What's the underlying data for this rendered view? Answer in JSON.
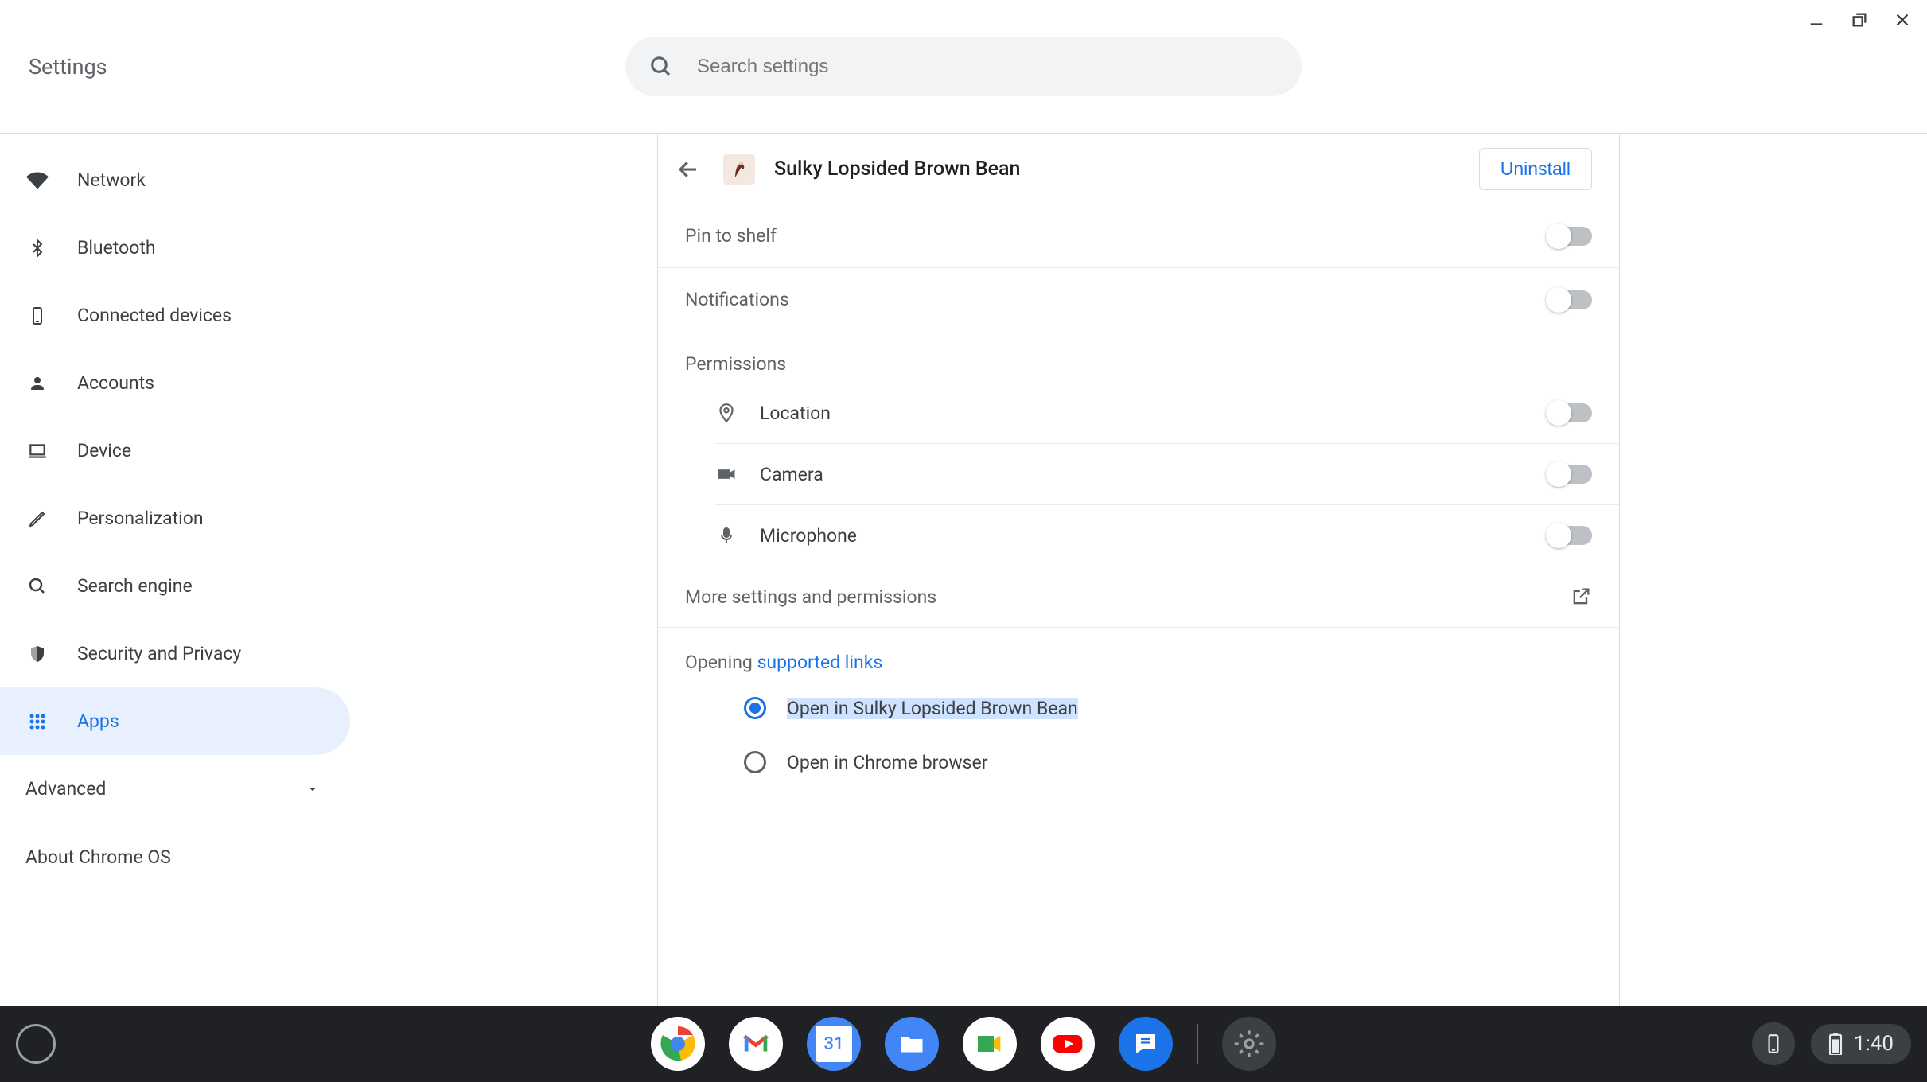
{
  "header": {
    "title": "Settings",
    "search_placeholder": "Search settings"
  },
  "sidebar": {
    "items": [
      {
        "label": "Network"
      },
      {
        "label": "Bluetooth"
      },
      {
        "label": "Connected devices"
      },
      {
        "label": "Accounts"
      },
      {
        "label": "Device"
      },
      {
        "label": "Personalization"
      },
      {
        "label": "Search engine"
      },
      {
        "label": "Security and Privacy"
      },
      {
        "label": "Apps"
      }
    ],
    "advanced": "Advanced",
    "about": "About Chrome OS"
  },
  "detail": {
    "app_name": "Sulky Lopsided Brown Bean",
    "uninstall": "Uninstall",
    "pin_to_shelf": "Pin to shelf",
    "notifications": "Notifications",
    "permissions_label": "Permissions",
    "permissions": {
      "location": "Location",
      "camera": "Camera",
      "microphone": "Microphone"
    },
    "more_settings": "More settings and permissions",
    "opening_prefix": "Opening ",
    "opening_link": "supported links",
    "radio_open_app": "Open in Sulky Lopsided Brown Bean",
    "radio_open_chrome": "Open in Chrome browser"
  },
  "shelf": {
    "time": "1:40"
  }
}
